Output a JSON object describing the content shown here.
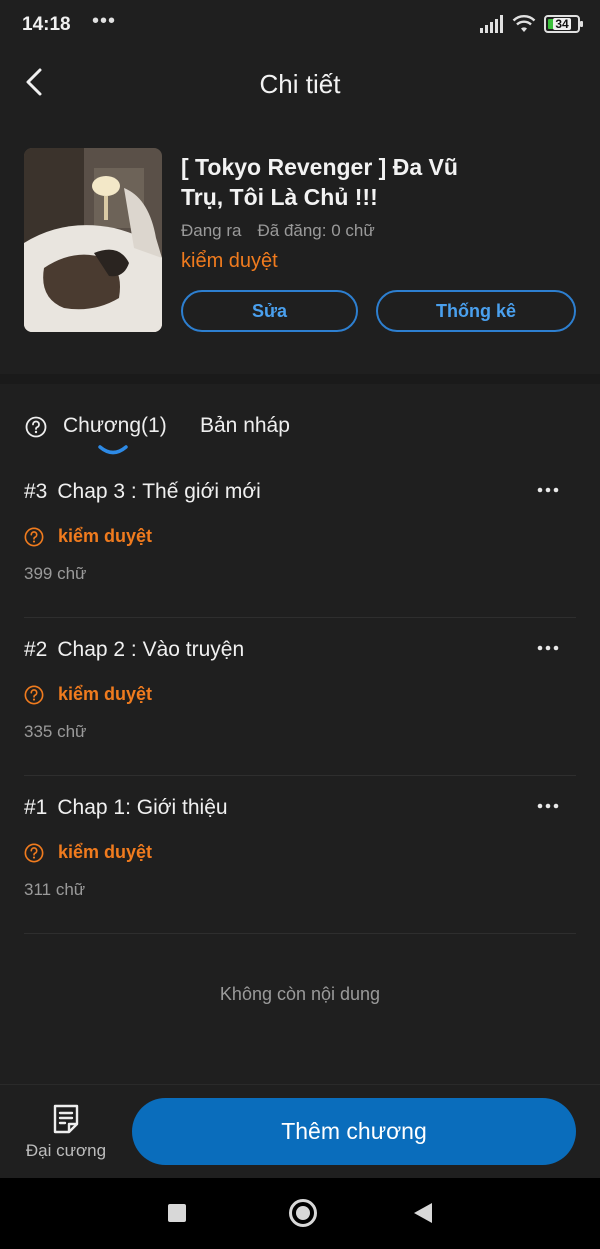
{
  "status_bar": {
    "time": "14:18",
    "dots": "•••",
    "battery": "34"
  },
  "header": {
    "title": "Chi tiết"
  },
  "book": {
    "title": "[ Tokyo Revenger ] Đa Vũ Trụ, Tôi Là Chủ !!!",
    "state": "Đang ra",
    "posted": "Đã đăng: 0 chữ",
    "review": "kiểm duyệt",
    "edit_label": "Sửa",
    "stats_label": "Thống kê"
  },
  "tabs": {
    "chapters": "Chương(1)",
    "drafts": "Bản nháp"
  },
  "chapters": [
    {
      "num": "#3",
      "title": "Chap 3 : Thế giới mới",
      "status": "kiểm duyệt",
      "words": "399 chữ"
    },
    {
      "num": "#2",
      "title": "Chap 2 : Vào truyện",
      "status": "kiểm duyệt",
      "words": "335 chữ"
    },
    {
      "num": "#1",
      "title": "Chap 1: Giới thiệu",
      "status": "kiểm duyệt",
      "words": "311 chữ"
    }
  ],
  "no_more": "Không còn nội dung",
  "bottom": {
    "outline_label": "Đại cương",
    "add_chapter_label": "Thêm chương"
  },
  "colors": {
    "accent_orange": "#f07b1e",
    "accent_blue": "#0a6dbc",
    "background": "#1f1f1f"
  }
}
